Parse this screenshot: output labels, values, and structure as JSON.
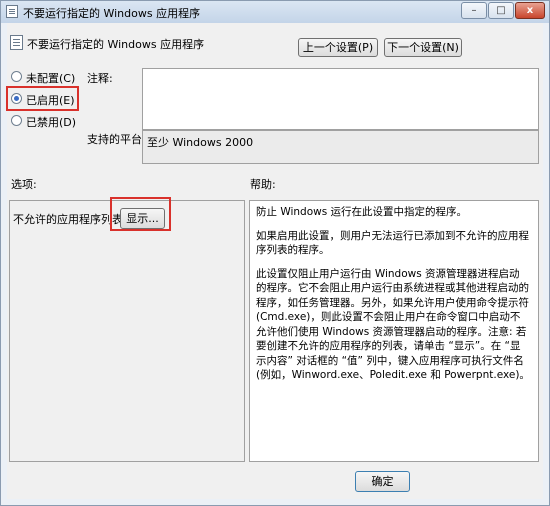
{
  "window": {
    "title": "不要运行指定的 Windows 应用程序",
    "minimize_label": "–",
    "maximize_label": "□",
    "close_label": "x"
  },
  "header": {
    "policy_title": "不要运行指定的 Windows 应用程序",
    "prev_button": "上一个设置(P)",
    "next_button": "下一个设置(N)"
  },
  "state": {
    "options": [
      {
        "label": "未配置(C)",
        "selected": false
      },
      {
        "label": "已启用(E)",
        "selected": true
      },
      {
        "label": "已禁用(D)",
        "selected": false
      }
    ]
  },
  "comment": {
    "label": "注释:",
    "value": ""
  },
  "platform": {
    "label": "支持的平台:",
    "value": "至少 Windows 2000"
  },
  "options_panel": {
    "label": "选项:",
    "list_label": "不允许的应用程序列表",
    "show_button": "显示..."
  },
  "help_panel": {
    "label": "帮助:",
    "paragraphs": [
      "防止 Windows 运行在此设置中指定的程序。",
      "如果启用此设置，则用户无法运行已添加到不允许的应用程序列表的程序。",
      "此设置仅阻止用户运行由 Windows 资源管理器进程启动的程序。它不会阻止用户运行由系统进程或其他进程启动的程序，如任务管理器。另外，如果允许用户使用命令提示符(Cmd.exe)，则此设置不会阻止用户在命令窗口中启动不允许他们使用 Windows 资源管理器启动的程序。注意: 若要创建不允许的应用程序的列表，请单击 “显示”。在 “显示内容” 对话框的 “值” 列中，键入应用程序可执行文件名(例如，Winword.exe、Poledit.exe 和 Powerpnt.exe)。"
    ]
  },
  "footer": {
    "ok_button": "确定"
  },
  "colors": {
    "highlight_border": "#d9312b",
    "radio_dot": "#3b6cc4"
  }
}
